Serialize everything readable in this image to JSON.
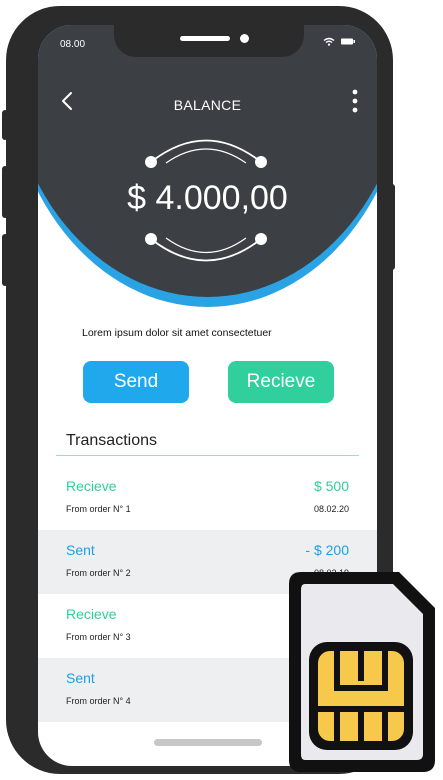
{
  "status_bar": {
    "time": "08.00"
  },
  "header": {
    "title": "BALANCE"
  },
  "balance": {
    "amount": "$ 4.000,00"
  },
  "intro_text": "Lorem ipsum dolor sit amet consectetuer",
  "actions": {
    "send_label": "Send",
    "receive_label": "Recieve"
  },
  "transactions": {
    "title": "Transactions",
    "items": [
      {
        "type": "Recieve",
        "kind": "receive",
        "from": "From order N° 1",
        "amount": "$ 500",
        "date": "08.02.20"
      },
      {
        "type": "Sent",
        "kind": "sent",
        "from": "From order N° 2",
        "amount": "- $ 200",
        "date": "08.02.19"
      },
      {
        "type": "Recieve",
        "kind": "receive",
        "from": "From order N° 3",
        "amount": "",
        "date": ""
      },
      {
        "type": "Sent",
        "kind": "sent",
        "from": "From order N° 4",
        "amount": "",
        "date": ""
      }
    ]
  },
  "colors": {
    "header_dark": "#3c3f44",
    "header_accent": "#29a3e4",
    "send": "#1fa8ec",
    "receive": "#30cf9b",
    "sim_chip": "#f6c94c"
  },
  "icons": [
    "back-arrow-icon",
    "more-vertical-icon",
    "wifi-icon",
    "battery-icon",
    "exchange-ring-icon",
    "sim-card-icon"
  ]
}
